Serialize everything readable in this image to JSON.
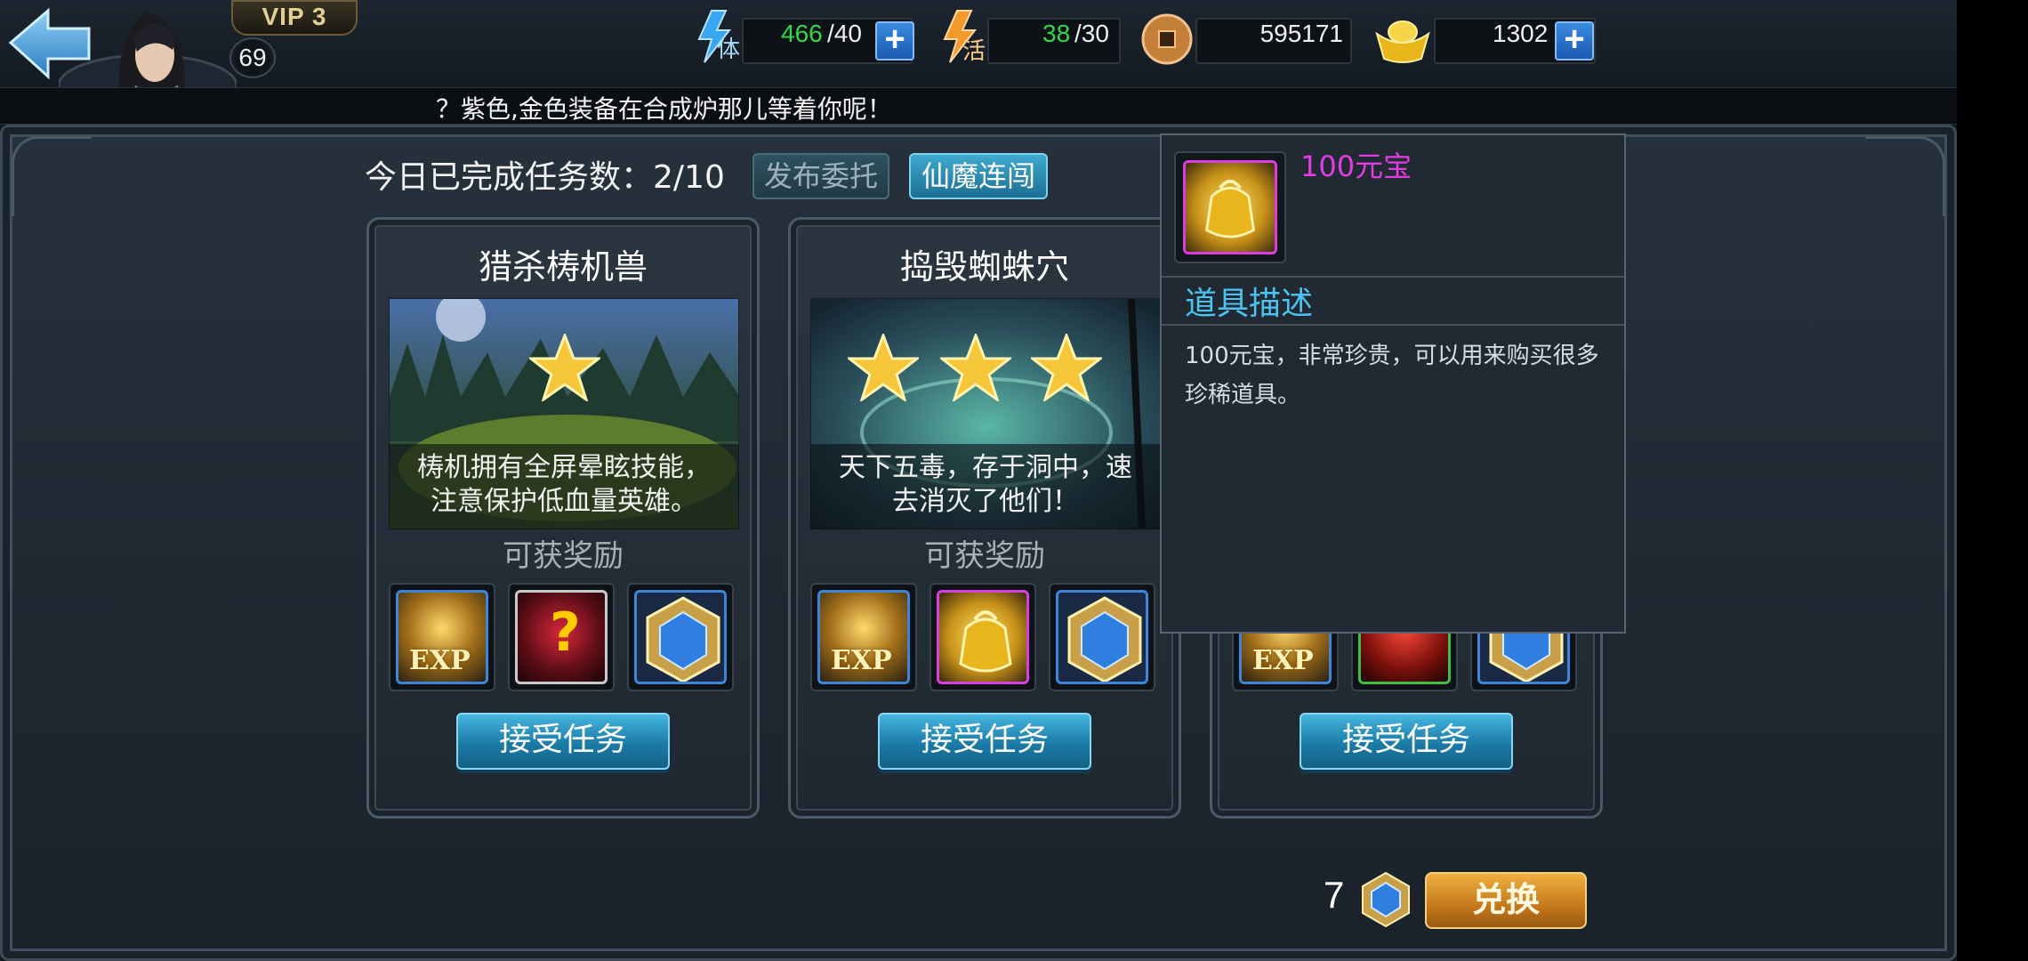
{
  "player": {
    "vip": "VIP 3",
    "level": "69"
  },
  "resources": {
    "stamina": {
      "icon_label": "体",
      "current": "466",
      "max": "/40",
      "current_color": "#33d84a"
    },
    "vitality": {
      "icon_label": "活",
      "current": "38",
      "max": "/30",
      "current_color": "#33d84a"
    },
    "copper": {
      "value": "595171"
    },
    "gold": {
      "value": "1302"
    }
  },
  "ticker": {
    "text": "？紫色,金色装备在合成炉那儿等着你呢！"
  },
  "header": {
    "tasks_done": "今日已完成任务数：2/10",
    "publish_label": "发布委托",
    "xianmo_label": "仙魔连闯"
  },
  "cards": [
    {
      "title": "猎杀梼机兽",
      "stars": 1,
      "desc_line1": "梼机拥有全屏晕眩技能，",
      "desc_line2": "注意保护低血量英雄。",
      "reward_label": "可获奖励",
      "rewards": [
        {
          "icon": "exp-icon",
          "badge": "EXP",
          "border": "#3b86d9"
        },
        {
          "icon": "mystery-equipment-icon",
          "badge": "?",
          "border": "#c9c9c9"
        },
        {
          "icon": "blue-gem-icon",
          "badge": "",
          "border": "#3b86d9"
        }
      ],
      "accept_label": "接受任务"
    },
    {
      "title": "捣毁蜘蛛穴",
      "stars": 3,
      "desc_line1": "天下五毒，存于洞中，速",
      "desc_line2": "去消灭了他们！",
      "reward_label": "可获奖励",
      "rewards": [
        {
          "icon": "exp-icon",
          "badge": "EXP",
          "border": "#3b86d9"
        },
        {
          "icon": "gold-ingot-bag-icon",
          "badge": "",
          "border": "#d93ee0"
        },
        {
          "icon": "blue-gem-icon",
          "badge": "",
          "border": "#3b86d9"
        }
      ],
      "accept_label": "接受任务"
    },
    {
      "title": "",
      "stars": 0,
      "desc_line1": "",
      "desc_line2": "",
      "reward_label": "",
      "rewards": [
        {
          "icon": "exp-icon",
          "badge": "EXP",
          "border": "#3b86d9"
        },
        {
          "icon": "red-item-icon",
          "badge": "",
          "border": "#3fbf3f"
        },
        {
          "icon": "blue-gem-icon",
          "badge": "",
          "border": "#3b86d9"
        }
      ],
      "accept_label": "接受任务"
    }
  ],
  "tooltip": {
    "item_name": "100元宝",
    "item_name_color": "#e23de3",
    "section_heading": "道具描述",
    "description": "100元宝，非常珍贵，可以用来购买很多珍稀道具。"
  },
  "exchange": {
    "count": "7",
    "button_label": "兑换"
  },
  "colors": {
    "accent_blue": "#3fa9cf",
    "gold_button": "#c4791b",
    "tooltip_heading": "#4cc3f0"
  }
}
